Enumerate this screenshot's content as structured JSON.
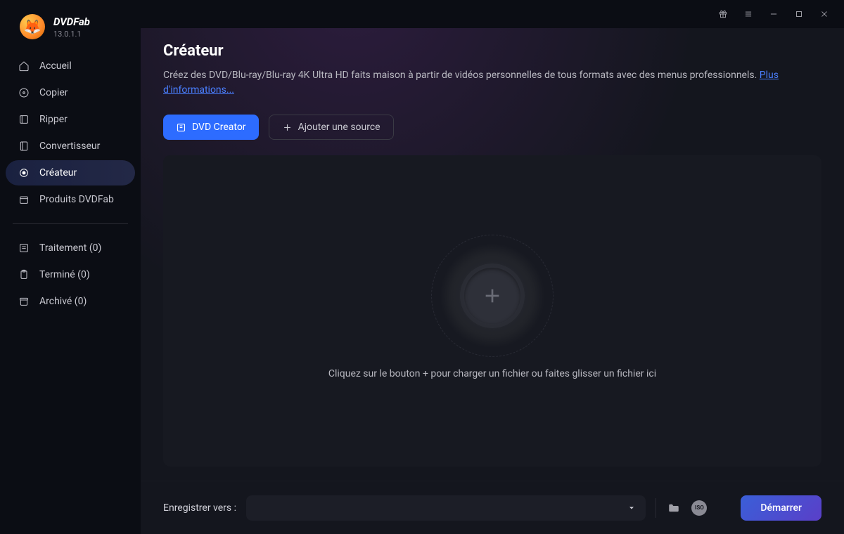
{
  "app": {
    "name": "DVDFab",
    "version": "13.0.1.1"
  },
  "sidebar": {
    "main": [
      {
        "id": "home",
        "label": "Accueil",
        "icon": "home-icon"
      },
      {
        "id": "copy",
        "label": "Copier",
        "icon": "disc-icon"
      },
      {
        "id": "ripper",
        "label": "Ripper",
        "icon": "ripper-icon"
      },
      {
        "id": "converter",
        "label": "Convertisseur",
        "icon": "converter-icon"
      },
      {
        "id": "creator",
        "label": "Créateur",
        "icon": "target-icon"
      },
      {
        "id": "products",
        "label": "Produits DVDFab",
        "icon": "box-icon"
      }
    ],
    "status": [
      {
        "id": "processing",
        "label": "Traitement (0)",
        "icon": "list-icon"
      },
      {
        "id": "done",
        "label": "Terminé (0)",
        "icon": "clipboard-icon"
      },
      {
        "id": "archived",
        "label": "Archivé (0)",
        "icon": "archive-icon"
      }
    ],
    "active": "creator"
  },
  "page": {
    "title": "Créateur",
    "description": "Créez des DVD/Blu-ray/Blu-ray 4K Ultra HD faits maison à partir de vidéos personnelles de tous formats avec des menus professionnels. ",
    "more_link": "Plus d'informations...",
    "creator_btn": "DVD Creator",
    "add_source_btn": "Ajouter une source",
    "dropzone_text": "Cliquez sur le bouton + pour charger un fichier ou faites glisser un fichier ici"
  },
  "footer": {
    "save_label": "Enregistrer vers :",
    "start_btn": "Démarrer",
    "iso_label": "ISO"
  }
}
